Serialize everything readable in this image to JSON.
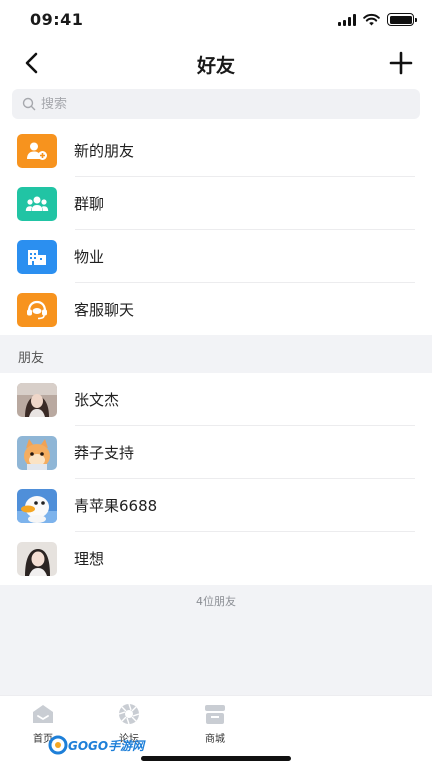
{
  "status_bar": {
    "time": "09:41"
  },
  "nav": {
    "title": "好友"
  },
  "search": {
    "placeholder": "搜索"
  },
  "features": [
    {
      "label": "新的朋友",
      "icon": "add-friend-icon",
      "color": "#f7931e"
    },
    {
      "label": "群聊",
      "icon": "group-icon",
      "color": "#21c4a4"
    },
    {
      "label": "物业",
      "icon": "building-icon",
      "color": "#2b8ff0"
    },
    {
      "label": "客服聊天",
      "icon": "headset-icon",
      "color": "#f7931e"
    }
  ],
  "section": {
    "title": "朋友"
  },
  "friends": [
    {
      "name": "张文杰",
      "avatar": "photo-avatar"
    },
    {
      "name": "莽子支持",
      "avatar": "cartoon-cat-avatar"
    },
    {
      "name": "青苹果6688",
      "avatar": "cartoon-duck-avatar"
    },
    {
      "name": "理想",
      "avatar": "photo-avatar"
    }
  ],
  "footer": {
    "count_text": "4位朋友"
  },
  "tabs": [
    {
      "label": "首页",
      "icon": "home-icon"
    },
    {
      "label": "论坛",
      "icon": "forum-icon"
    },
    {
      "label": "商城",
      "icon": "shop-icon"
    }
  ],
  "watermark": {
    "text": "GOGO手游网"
  }
}
